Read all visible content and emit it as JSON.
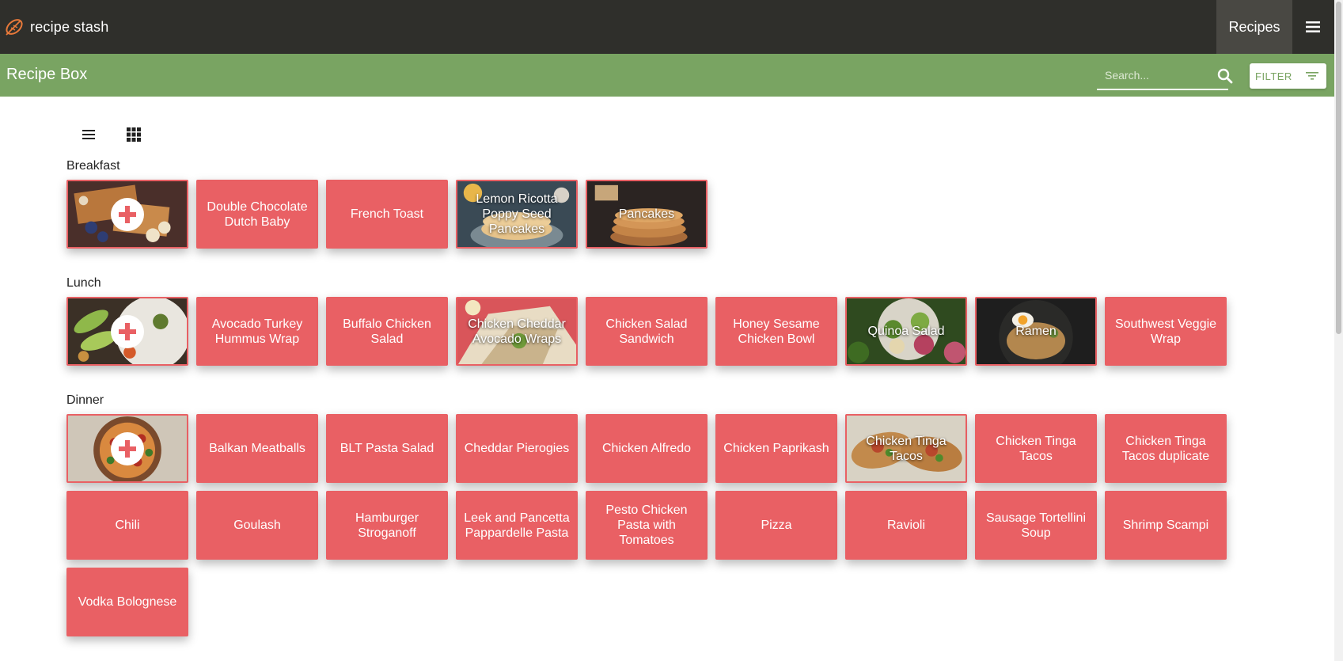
{
  "app": {
    "brand": "recipe stash"
  },
  "nav": {
    "recipes_label": "Recipes"
  },
  "subbar": {
    "title": "Recipe Box",
    "search_placeholder": "Search...",
    "filter_label": "FILTER"
  },
  "colors": {
    "topbar": "#2f2f2b",
    "subbar": "#79a462",
    "tile": "#e96064"
  },
  "sections": [
    {
      "label": "Breakfast",
      "add_icon": "plus-icon",
      "recipes": [
        "Double Chocolate Dutch Baby",
        "French Toast",
        "Lemon Ricotta Poppy Seed Pancakes",
        "Pancakes"
      ]
    },
    {
      "label": "Lunch",
      "add_icon": "plus-icon",
      "recipes": [
        "Avocado Turkey Hummus Wrap",
        "Buffalo Chicken Salad",
        "Chicken Cheddar Avocado Wraps",
        "Chicken Salad Sandwich",
        "Honey Sesame Chicken Bowl",
        "Quinoa Salad",
        "Ramen",
        "Southwest Veggie Wrap"
      ]
    },
    {
      "label": "Dinner",
      "add_icon": "plus-icon",
      "recipes": [
        "Balkan Meatballs",
        "BLT Pasta Salad",
        "Cheddar Pierogies",
        "Chicken Alfredo",
        "Chicken Paprikash",
        "Chicken Tinga Tacos",
        "Chicken Tinga Tacos",
        "Chicken Tinga Tacos duplicate",
        "Chili",
        "Goulash",
        "Hamburger Stroganoff",
        "Leek and Pancetta Pappardelle Pasta",
        "Pesto Chicken Pasta with Tomatoes",
        "Pizza",
        "Ravioli",
        "Sausage Tortellini Soup",
        "Shrimp Scampi",
        "Vodka Bolognese"
      ]
    }
  ]
}
